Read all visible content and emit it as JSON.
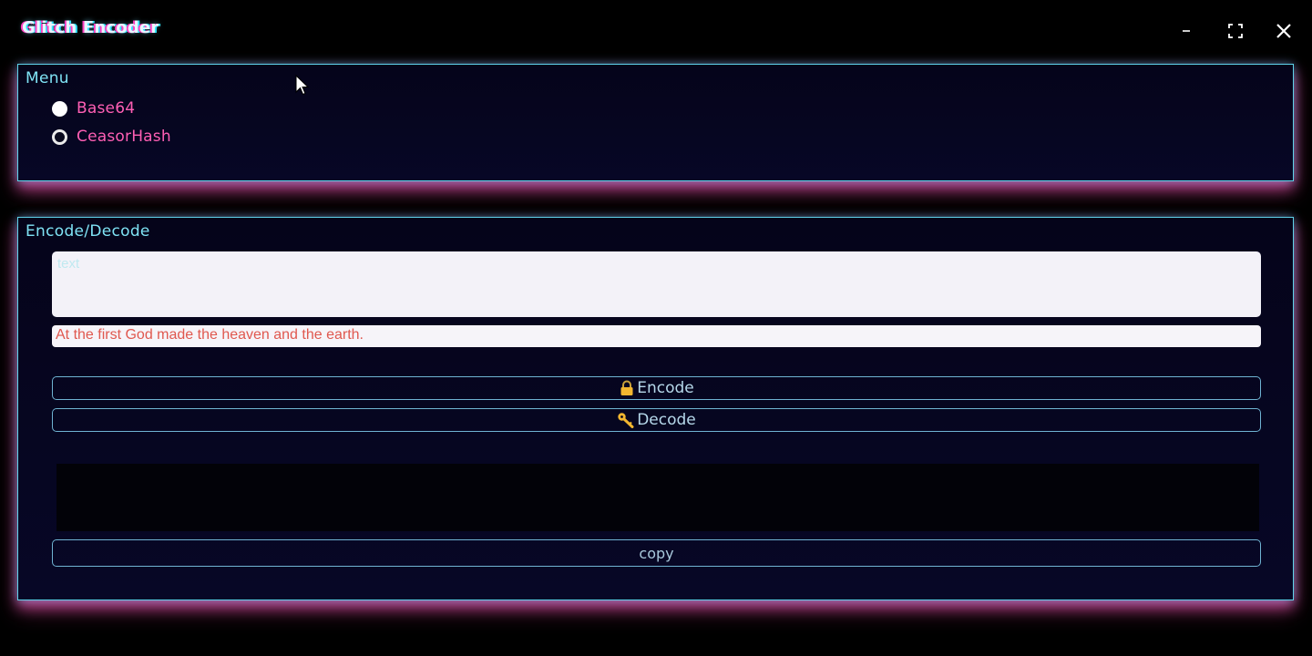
{
  "window": {
    "title": "Glitch Encoder",
    "controls": [
      "minimize",
      "maximize",
      "close"
    ]
  },
  "menu": {
    "title": "Menu",
    "options": [
      {
        "label": "Base64",
        "selected": true
      },
      {
        "label": "CeasorHash",
        "selected": false
      }
    ]
  },
  "encoder": {
    "title": "Encode/Decode",
    "input_placeholder": "text",
    "hint_text": "At the first God made the heaven and the earth.",
    "encode_label": "Encode",
    "decode_label": "Decode",
    "copy_label": "copy",
    "output_text": ""
  },
  "colors": {
    "accent_cyan": "#5fd3ea",
    "accent_pink": "#ff5fb4",
    "background": "#000000",
    "panel": "#05041a"
  },
  "icons": {
    "encode": "lock-icon",
    "decode": "key-icon"
  }
}
